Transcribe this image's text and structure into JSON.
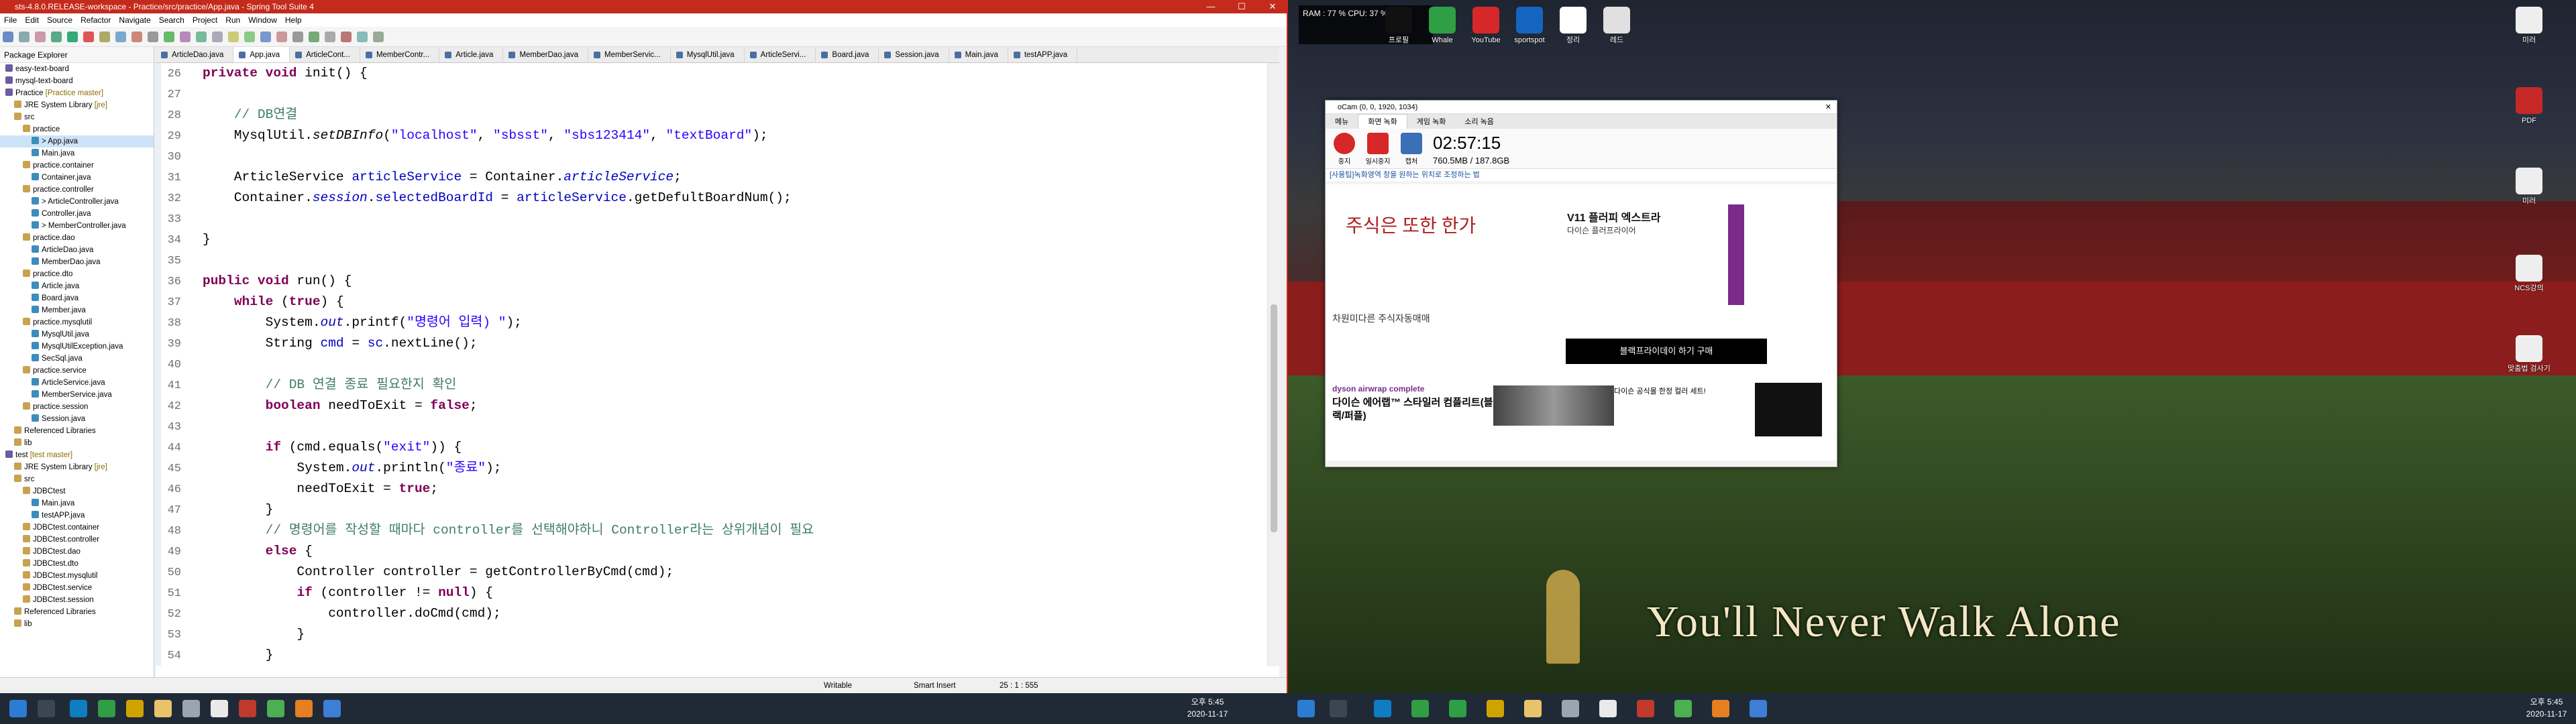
{
  "ide": {
    "title": "sts-4.8.0.RELEASE-workspace - Practice/src/practice/App.java - Spring Tool Suite 4",
    "menu": [
      "File",
      "Edit",
      "Source",
      "Refactor",
      "Navigate",
      "Search",
      "Project",
      "Run",
      "Window",
      "Help"
    ],
    "package_explorer_title": "Package Explorer",
    "tree": [
      {
        "label": "easy-text-board",
        "indent": 0
      },
      {
        "label": "mysql-text-board",
        "indent": 0
      },
      {
        "label": "Practice",
        "decor": " [Practice master]",
        "indent": 0
      },
      {
        "label": "JRE System Library",
        "decor": " [jre]",
        "indent": 1
      },
      {
        "label": "src",
        "indent": 1
      },
      {
        "label": "practice",
        "indent": 2
      },
      {
        "label": "> App.java",
        "indent": 3,
        "selected": true
      },
      {
        "label": "Main.java",
        "indent": 3
      },
      {
        "label": "practice.container",
        "indent": 2
      },
      {
        "label": "Container.java",
        "indent": 3
      },
      {
        "label": "practice.controller",
        "indent": 2
      },
      {
        "label": "> ArticleController.java",
        "indent": 3
      },
      {
        "label": "Controller.java",
        "indent": 3
      },
      {
        "label": "> MemberController.java",
        "indent": 3
      },
      {
        "label": "practice.dao",
        "indent": 2
      },
      {
        "label": "ArticleDao.java",
        "indent": 3
      },
      {
        "label": "MemberDao.java",
        "indent": 3
      },
      {
        "label": "practice.dto",
        "indent": 2
      },
      {
        "label": "Article.java",
        "indent": 3
      },
      {
        "label": "Board.java",
        "indent": 3
      },
      {
        "label": "Member.java",
        "indent": 3
      },
      {
        "label": "practice.mysqlutil",
        "indent": 2
      },
      {
        "label": "MysqlUtil.java",
        "indent": 3
      },
      {
        "label": "MysqlUtilException.java",
        "indent": 3
      },
      {
        "label": "SecSql.java",
        "indent": 3
      },
      {
        "label": "practice.service",
        "indent": 2
      },
      {
        "label": "ArticleService.java",
        "indent": 3
      },
      {
        "label": "MemberService.java",
        "indent": 3
      },
      {
        "label": "practice.session",
        "indent": 2
      },
      {
        "label": "Session.java",
        "indent": 3
      },
      {
        "label": "Referenced Libraries",
        "indent": 1
      },
      {
        "label": "lib",
        "indent": 1
      },
      {
        "label": "test",
        "decor": " [test master]",
        "indent": 0
      },
      {
        "label": "JRE System Library",
        "decor": " [jre]",
        "indent": 1
      },
      {
        "label": "src",
        "indent": 1
      },
      {
        "label": "JDBCtest",
        "indent": 2
      },
      {
        "label": "Main.java",
        "indent": 3
      },
      {
        "label": "testAPP.java",
        "indent": 3
      },
      {
        "label": "JDBCtest.container",
        "indent": 2
      },
      {
        "label": "JDBCtest.controller",
        "indent": 2
      },
      {
        "label": "JDBCtest.dao",
        "indent": 2
      },
      {
        "label": "JDBCtest.dto",
        "indent": 2
      },
      {
        "label": "JDBCtest.mysqlutil",
        "indent": 2
      },
      {
        "label": "JDBCtest.service",
        "indent": 2
      },
      {
        "label": "JDBCtest.session",
        "indent": 2
      },
      {
        "label": "Referenced Libraries",
        "indent": 1
      },
      {
        "label": "lib",
        "indent": 1
      }
    ],
    "tabs": [
      "ArticleDao.java",
      "App.java",
      "ArticleCont...",
      "MemberContr...",
      "Article.java",
      "MemberDao.java",
      "MemberServic...",
      "MysqlUtil.java",
      "ArticleServi...",
      "Board.java",
      "Session.java",
      "Main.java",
      "testAPP.java"
    ],
    "active_tab": 1,
    "code": [
      {
        "n": "26",
        "html": "<span class='kw'>private void</span> init() {"
      },
      {
        "n": "27",
        "html": ""
      },
      {
        "n": "28",
        "html": "    <span class='cm'>// DB연결</span>"
      },
      {
        "n": "29",
        "html": "    MysqlUtil.<span class='it'>setDBInfo</span>(<span class='st'>\"localhost\"</span>, <span class='st'>\"sbsst\"</span>, <span class='st'>\"sbs123414\"</span>, <span class='st'>\"textBoard\"</span>);"
      },
      {
        "n": "30",
        "html": ""
      },
      {
        "n": "31",
        "html": "    ArticleService <span class='fd'>articleService</span> = Container.<span class='fd it'>articleService</span>;"
      },
      {
        "n": "32",
        "html": "    Container.<span class='fd it'>session</span>.<span class='fd'>selectedBoardId</span> = <span class='fd'>articleService</span>.getDefultBoardNum();"
      },
      {
        "n": "33",
        "html": ""
      },
      {
        "n": "34",
        "html": "}"
      },
      {
        "n": "35",
        "html": ""
      },
      {
        "n": "36",
        "html": "<span class='kw'>public void</span> run() {"
      },
      {
        "n": "37",
        "html": "    <span class='kw'>while</span> (<span class='kw'>true</span>) {"
      },
      {
        "n": "38",
        "html": "        System.<span class='fd it'>out</span>.printf(<span class='st'>\"명령어 입력) \"</span>);"
      },
      {
        "n": "39",
        "html": "        String <span class='fd'>cmd</span> = <span class='fd'>sc</span>.nextLine();"
      },
      {
        "n": "40",
        "html": ""
      },
      {
        "n": "41",
        "html": "        <span class='cm'>// DB 연결 종료 필요한지 확인</span>"
      },
      {
        "n": "42",
        "html": "        <span class='kw'>boolean</span> needToExit = <span class='kw'>false</span>;"
      },
      {
        "n": "43",
        "html": ""
      },
      {
        "n": "44",
        "html": "        <span class='kw'>if</span> (cmd.equals(<span class='st'>\"exit\"</span>)) {"
      },
      {
        "n": "45",
        "html": "            System.<span class='fd it'>out</span>.println(<span class='st'>\"종료\"</span>);"
      },
      {
        "n": "46",
        "html": "            needToExit = <span class='kw'>true</span>;"
      },
      {
        "n": "47",
        "html": "        }"
      },
      {
        "n": "48",
        "html": "        <span class='cm'>// 명령어를 작성할 때마다 controller를 선택해야하니 Controller라는 상위개념이 필요</span>"
      },
      {
        "n": "49",
        "html": "        <span class='kw'>else</span> {"
      },
      {
        "n": "50",
        "html": "            Controller controller = getControllerByCmd(cmd);"
      },
      {
        "n": "51",
        "html": "            <span class='kw'>if</span> (controller != <span class='kw'>null</span>) {"
      },
      {
        "n": "52",
        "html": "                controller.doCmd(cmd);"
      },
      {
        "n": "53",
        "html": "            }"
      },
      {
        "n": "54",
        "html": "        }"
      }
    ],
    "status": {
      "writable": "Writable",
      "insert": "Smart Insert",
      "position": "25 : 1 : 555"
    }
  },
  "taskbar": {
    "time": "오후 5:45",
    "date": "2020-11-17"
  },
  "desktop": {
    "resmon": "RAM : 77 %  CPU: 37 %",
    "icons_top": [
      "프로필",
      "Whale",
      "YouTube",
      "sportspot",
      "정리",
      "레드"
    ],
    "icons_right": [
      "미러",
      "PDF",
      "미러",
      "NCS강의",
      "맞춤법 검사기"
    ],
    "slogan": "You'll Never Walk Alone"
  },
  "ocam": {
    "title": "oCam (0, 0, 1920, 1034)",
    "tabs": [
      "메뉴",
      "화면 녹화",
      "게임 녹화",
      "소리 녹음"
    ],
    "buttons": [
      "중지",
      "일시중지",
      "캡처"
    ],
    "elapsed": "02:57:15",
    "size": "760.5MB / 187.8GB",
    "ad_note": "[사용팁]녹화영역 창을 원하는 위치로 조정하는 법",
    "ad_brand": "주식은 또한 한가",
    "ad_text1": "차원미다른 주식자동매매",
    "ad_product": "V11 플러피 엑스트라",
    "ad_sub": "다이슨 플러프라이어",
    "ad_button": "블랙프라이데이 하기 구매",
    "ad_bottom": "다이슨 에어랩™ 스타일러 컴플리트(블랙/퍼플)",
    "ad_bottom_brand": "dyson airwrap complete",
    "ad_right": "다이슨 공식몰 한정 컬러 세트!"
  }
}
